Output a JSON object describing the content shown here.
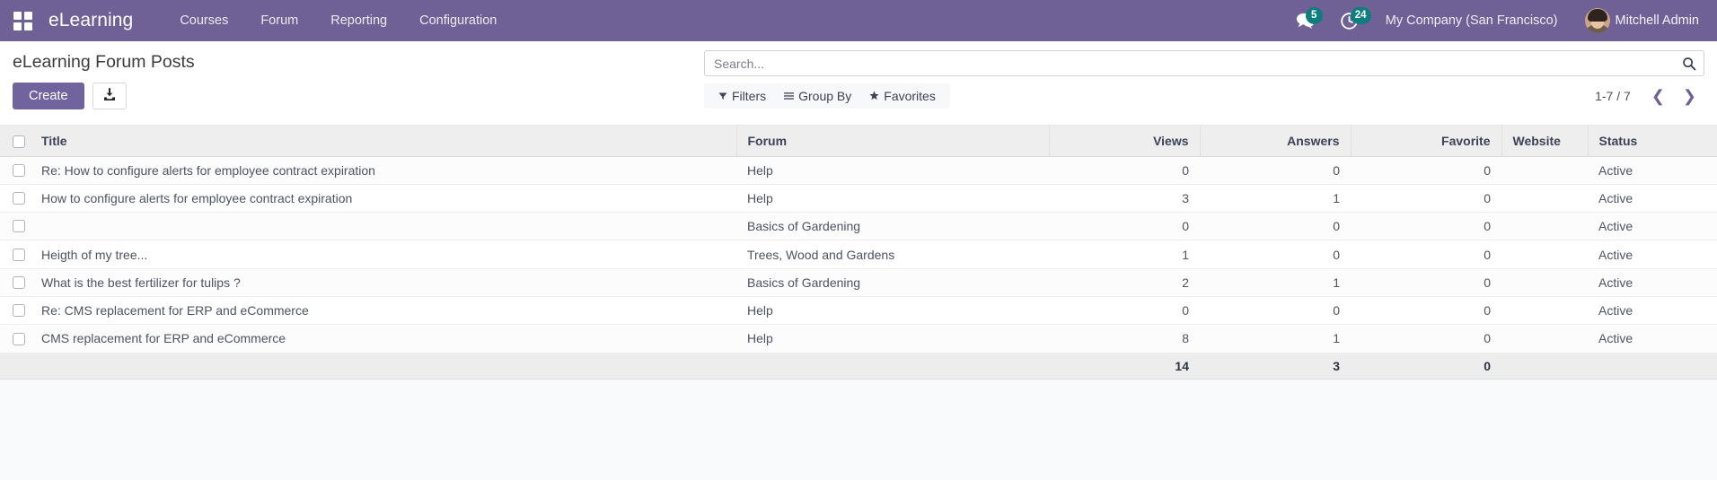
{
  "navbar": {
    "apps_icon": "apps-grid-icon",
    "brand": "eLearning",
    "menu": [
      {
        "label": "Courses"
      },
      {
        "label": "Forum"
      },
      {
        "label": "Reporting"
      },
      {
        "label": "Configuration"
      }
    ],
    "messages_icon": "messages-icon",
    "messages_count": "5",
    "activities_icon": "activity-clock-icon",
    "activities_count": "24",
    "company": "My Company (San Francisco)",
    "user": "Mitchell Admin",
    "accent_color": "#6f6196",
    "badge_color": "#0d7d7d"
  },
  "control_panel": {
    "title": "eLearning Forum Posts",
    "create_label": "Create",
    "import_icon": "import-download-icon",
    "search": {
      "placeholder": "Search...",
      "value": "",
      "icon": "search-icon"
    },
    "facets": [
      {
        "label": "Filters",
        "icon": "filter-funnel-icon"
      },
      {
        "label": "Group By",
        "icon": "group-lines-icon"
      },
      {
        "label": "Favorites",
        "icon": "star-icon"
      }
    ],
    "pager": {
      "range": "1-7 / 7",
      "prev_icon": "chevron-left-icon",
      "next_icon": "chevron-right-icon"
    }
  },
  "table": {
    "columns": [
      {
        "label": "Title",
        "align": "left"
      },
      {
        "label": "Forum",
        "align": "left"
      },
      {
        "label": "Views",
        "align": "right"
      },
      {
        "label": "Answers",
        "align": "right"
      },
      {
        "label": "Favorite",
        "align": "right"
      },
      {
        "label": "Website",
        "align": "left"
      },
      {
        "label": "Status",
        "align": "left"
      }
    ],
    "rows": [
      {
        "title": "Re: How to configure alerts for employee contract expiration",
        "forum": "Help",
        "views": "0",
        "answers": "0",
        "favorite": "0",
        "website": "",
        "status": "Active"
      },
      {
        "title": "How to configure alerts for employee contract expiration",
        "forum": "Help",
        "views": "3",
        "answers": "1",
        "favorite": "0",
        "website": "",
        "status": "Active"
      },
      {
        "title": "",
        "forum": "Basics of Gardening",
        "views": "0",
        "answers": "0",
        "favorite": "0",
        "website": "",
        "status": "Active"
      },
      {
        "title": "Heigth of my tree...",
        "forum": "Trees, Wood and Gardens",
        "views": "1",
        "answers": "0",
        "favorite": "0",
        "website": "",
        "status": "Active"
      },
      {
        "title": "What is the best fertilizer for tulips ?",
        "forum": "Basics of Gardening",
        "views": "2",
        "answers": "1",
        "favorite": "0",
        "website": "",
        "status": "Active"
      },
      {
        "title": "Re: CMS replacement for ERP and eCommerce",
        "forum": "Help",
        "views": "0",
        "answers": "0",
        "favorite": "0",
        "website": "",
        "status": "Active"
      },
      {
        "title": "CMS replacement for ERP and eCommerce",
        "forum": "Help",
        "views": "8",
        "answers": "1",
        "favorite": "0",
        "website": "",
        "status": "Active"
      }
    ],
    "totals": {
      "views": "14",
      "answers": "3",
      "favorite": "0"
    }
  }
}
